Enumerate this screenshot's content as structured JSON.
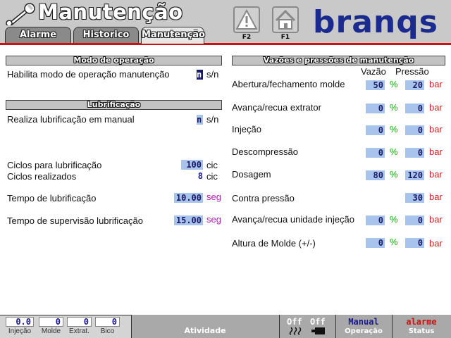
{
  "header": {
    "title": "Manutenção",
    "tabs": [
      {
        "label": "Alarme"
      },
      {
        "label": "Historico"
      },
      {
        "label": "Manutenção"
      }
    ],
    "fkeys": [
      {
        "label": "F2",
        "icon": "warning-icon"
      },
      {
        "label": "F1",
        "icon": "home-icon"
      }
    ],
    "logo": "branqs"
  },
  "left": {
    "modo_title": "Modo de operação",
    "habilita_label": "Habilita modo de operação manutenção",
    "habilita_value": "n",
    "habilita_unit": "s/n",
    "lub_title": "Lubrificação",
    "realiza_label": "Realiza lubrificação em manual",
    "realiza_value": "n",
    "realiza_unit": "s/n",
    "ciclos_lub_label": "Ciclos para lubrificação",
    "ciclos_lub_value": "100",
    "ciclos_lub_unit": "cic",
    "ciclos_real_label": "Ciclos realizados",
    "ciclos_real_value": "8",
    "ciclos_real_unit": "cic",
    "tempo_lub_label": "Tempo de lubrificação",
    "tempo_lub_value": "10.00",
    "tempo_lub_unit": "seg",
    "tempo_sup_label": "Tempo de supervisão lubrificação",
    "tempo_sup_value": "15.00",
    "tempo_sup_unit": "seg"
  },
  "right": {
    "title": "Vazões e pressões de manutenção",
    "col_vazao": "Vazão",
    "col_pressao": "Pressão",
    "unit_vazao": "%",
    "unit_pressao": "bar",
    "rows": [
      {
        "label": "Abertura/fechamento molde",
        "vazao": "50",
        "pressao": "20"
      },
      {
        "label": "Avança/recua extrator",
        "vazao": "0",
        "pressao": "0"
      },
      {
        "label": "Injeção",
        "vazao": "0",
        "pressao": "0"
      },
      {
        "label": "Descompressão",
        "vazao": "0",
        "pressao": "0"
      },
      {
        "label": "Dosagem",
        "vazao": "80",
        "pressao": "120"
      },
      {
        "label": "Contra pressão",
        "vazao": "",
        "pressao": "30"
      },
      {
        "label": "Avança/recua unidade injeção",
        "vazao": "0",
        "pressao": "0"
      },
      {
        "label": "Altura de Molde (+/-)",
        "vazao": "0",
        "pressao": "0"
      }
    ]
  },
  "footer": {
    "injecao_value": "0.0",
    "injecao_label": "Injeção",
    "molde_value": "0",
    "molde_label": "Molde",
    "extrat_value": "0",
    "extrat_label": "Extrat.",
    "bico_value": "0",
    "bico_label": "Bico",
    "atividade_label": "Atividade",
    "off1": "Off",
    "off2": "Off",
    "operacao_value": "Manual",
    "operacao_label": "Operação",
    "status_value": "alarme",
    "status_label": "Status"
  }
}
